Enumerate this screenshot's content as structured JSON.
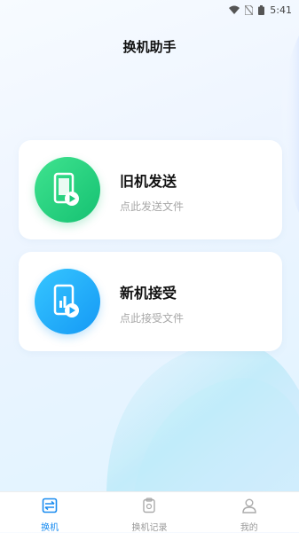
{
  "status_bar": {
    "time": "5:41",
    "icons": [
      "wifi-icon",
      "no-sim-icon",
      "battery-icon"
    ]
  },
  "header": {
    "title": "换机助手"
  },
  "cards": [
    {
      "title": "旧机发送",
      "subtitle": "点此发送文件",
      "icon": "phone-send-icon",
      "color": "#1ec97b"
    },
    {
      "title": "新机接受",
      "subtitle": "点此接受文件",
      "icon": "phone-receive-icon",
      "color": "#1aa6f7"
    }
  ],
  "tab_bar": {
    "items": [
      {
        "label": "换机",
        "icon": "transfer-icon",
        "active": true
      },
      {
        "label": "换机记录",
        "icon": "history-icon",
        "active": false
      },
      {
        "label": "我的",
        "icon": "profile-icon",
        "active": false
      }
    ],
    "accent": "#1a8cf0"
  }
}
